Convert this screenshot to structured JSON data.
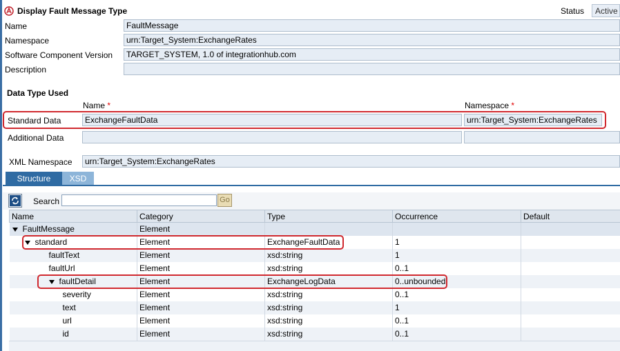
{
  "header": {
    "title": "Display Fault Message Type",
    "status_label": "Status",
    "status_value": "Active"
  },
  "form": {
    "name_label": "Name",
    "name_value": "FaultMessage",
    "namespace_label": "Namespace",
    "namespace_value": "urn:Target_System:ExchangeRates",
    "swcv_label": "Software Component Version",
    "swcv_value": "TARGET_SYSTEM, 1.0 of integrationhub.com",
    "description_label": "Description",
    "description_value": ""
  },
  "data_type_used": {
    "section_title": "Data Type Used",
    "col_name": "Name",
    "col_namespace": "Namespace",
    "required_mark": "*",
    "standard_label": "Standard Data",
    "standard_name": "ExchangeFaultData",
    "standard_namespace": "urn:Target_System:ExchangeRates",
    "additional_label": "Additional Data",
    "additional_name": "",
    "additional_namespace": "",
    "xml_namespace_label": "XML Namespace",
    "xml_namespace_value": "urn:Target_System:ExchangeRates"
  },
  "tabs": [
    {
      "label": "Structure",
      "active": true
    },
    {
      "label": "XSD",
      "active": false
    }
  ],
  "toolbar": {
    "search_label": "Search",
    "search_value": "",
    "go_label": "Go"
  },
  "tree": {
    "columns": [
      "Name",
      "Category",
      "Type",
      "Occurrence",
      "Default"
    ],
    "rows": [
      {
        "name": "FaultMessage",
        "category": "Element",
        "type": "",
        "occurrence": "",
        "default": "",
        "depth": 0,
        "expandable": true
      },
      {
        "name": "standard",
        "category": "Element",
        "type": "ExchangeFaultData",
        "occurrence": "1",
        "default": "",
        "depth": 1,
        "expandable": true
      },
      {
        "name": "faultText",
        "category": "Element",
        "type": "xsd:string",
        "occurrence": "1",
        "default": "",
        "depth": 2,
        "expandable": false
      },
      {
        "name": "faultUrl",
        "category": "Element",
        "type": "xsd:string",
        "occurrence": "0..1",
        "default": "",
        "depth": 2,
        "expandable": false
      },
      {
        "name": "faultDetail",
        "category": "Element",
        "type": "ExchangeLogData",
        "occurrence": "0..unbounded",
        "default": "",
        "depth": 2,
        "expandable": true
      },
      {
        "name": "severity",
        "category": "Element",
        "type": "xsd:string",
        "occurrence": "0..1",
        "default": "",
        "depth": 3,
        "expandable": false
      },
      {
        "name": "text",
        "category": "Element",
        "type": "xsd:string",
        "occurrence": "1",
        "default": "",
        "depth": 3,
        "expandable": false
      },
      {
        "name": "url",
        "category": "Element",
        "type": "xsd:string",
        "occurrence": "0..1",
        "default": "",
        "depth": 3,
        "expandable": false
      },
      {
        "name": "id",
        "category": "Element",
        "type": "xsd:string",
        "occurrence": "0..1",
        "default": "",
        "depth": 3,
        "expandable": false
      }
    ]
  },
  "colors": {
    "tab_active": "#2f6ba3",
    "tab_inactive": "#8db5d9",
    "highlight": "#d0282e",
    "field_bg": "#e6edf5"
  }
}
